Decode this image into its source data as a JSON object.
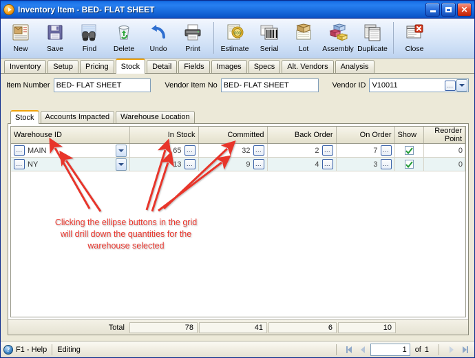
{
  "window": {
    "title": "Inventory Item - BED- FLAT SHEET",
    "icon": "orange-play-icon",
    "minimize_label": "Minimize",
    "maximize_label": "Maximize",
    "close_label": "Close"
  },
  "toolbar": {
    "buttons": [
      {
        "label": "New",
        "icon": "new-document-icon"
      },
      {
        "label": "Save",
        "icon": "floppy-disk-icon"
      },
      {
        "label": "Find",
        "icon": "binoculars-icon"
      },
      {
        "label": "Delete",
        "icon": "recycle-bin-icon"
      },
      {
        "label": "Undo",
        "icon": "undo-arrow-icon"
      },
      {
        "label": "Print",
        "icon": "printer-icon"
      },
      {
        "label": "Estimate",
        "icon": "estimate-money-icon"
      },
      {
        "label": "Serial",
        "icon": "barcode-icon"
      },
      {
        "label": "Lot",
        "icon": "lot-box-icon"
      },
      {
        "label": "Assembly",
        "icon": "assembly-blocks-icon"
      },
      {
        "label": "Duplicate",
        "icon": "duplicate-pages-icon"
      },
      {
        "label": "Close",
        "icon": "close-window-icon"
      }
    ]
  },
  "tabs": {
    "items": [
      {
        "label": "Inventory",
        "active": false
      },
      {
        "label": "Setup",
        "active": false
      },
      {
        "label": "Pricing",
        "active": false
      },
      {
        "label": "Stock",
        "active": true
      },
      {
        "label": "Detail",
        "active": false
      },
      {
        "label": "Fields",
        "active": false
      },
      {
        "label": "Images",
        "active": false
      },
      {
        "label": "Specs",
        "active": false
      },
      {
        "label": "Alt. Vendors",
        "active": false
      },
      {
        "label": "Analysis",
        "active": false
      }
    ]
  },
  "form": {
    "item_number_label": "Item Number",
    "item_number_value": "BED- FLAT SHEET",
    "vendor_item_no_label": "Vendor Item No",
    "vendor_item_no_value": "BED- FLAT SHEET",
    "vendor_id_label": "Vendor ID",
    "vendor_id_value": "V10011",
    "ellipsis_label": "...",
    "dropdown_icon": "chevron-down-icon"
  },
  "inner_tabs": {
    "items": [
      {
        "label": "Stock",
        "active": true
      },
      {
        "label": "Accounts Impacted",
        "active": false
      },
      {
        "label": "Warehouse Location",
        "active": false
      }
    ]
  },
  "grid": {
    "columns": [
      "Warehouse ID",
      "In Stock",
      "Committed",
      "Back Order",
      "On Order",
      "Show",
      "Reorder Point"
    ],
    "rows": [
      {
        "warehouse_id": "MAIN",
        "in_stock": "65",
        "committed": "32",
        "back_order": "2",
        "on_order": "7",
        "show": true,
        "reorder_point": "0",
        "selected": false
      },
      {
        "warehouse_id": "NY",
        "in_stock": "13",
        "committed": "9",
        "back_order": "4",
        "on_order": "3",
        "show": true,
        "reorder_point": "0",
        "selected": true
      }
    ],
    "ellipsis_label": "...",
    "totals": {
      "label": "Total",
      "in_stock": "78",
      "committed": "41",
      "back_order": "6",
      "on_order": "10"
    }
  },
  "annotation": {
    "line1": "Clicking the ellipse buttons in the grid",
    "line2": "will drill down the quantities for the",
    "line3": "warehouse selected",
    "color": "#e8352c"
  },
  "statusbar": {
    "help_label": "F1 - Help",
    "help_icon": "question-mark-icon",
    "mode": "Editing",
    "first_icon": "first-record-icon",
    "prev_icon": "previous-record-icon",
    "page_value": "1",
    "of_label": "of",
    "page_total": "1",
    "next_icon": "next-record-icon",
    "last_icon": "last-record-icon"
  },
  "colors": {
    "title_blue": "#1c6fe0",
    "accent_orange": "#f0a30a",
    "annotation_red": "#e8352c",
    "panel_beige": "#ece9d8",
    "selected_row": "#eaf4f4"
  }
}
